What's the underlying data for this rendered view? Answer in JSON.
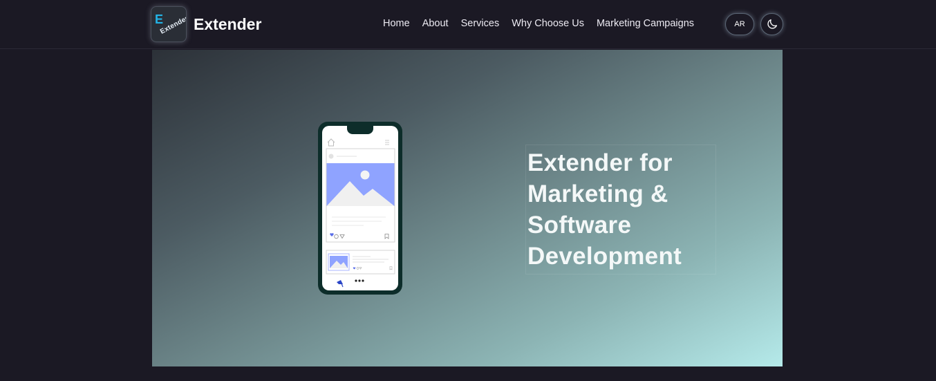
{
  "brand": {
    "name": "Extender",
    "logo_text": "Extender",
    "logo_initial": "E"
  },
  "nav": {
    "items": [
      "Home",
      "About",
      "Services",
      "Why Choose Us",
      "Marketing Campaigns"
    ]
  },
  "controls": {
    "language_label": "AR",
    "theme_icon": "moon-icon"
  },
  "hero": {
    "title": "Extender for Marketing & Software Development",
    "illustration": "phone-feed-illustration",
    "colors": {
      "gradient_start": "#2c3138",
      "gradient_end": "#b5eaea",
      "phone_frame": "#0d2d2a",
      "image_accent": "#8fa3ff"
    }
  }
}
